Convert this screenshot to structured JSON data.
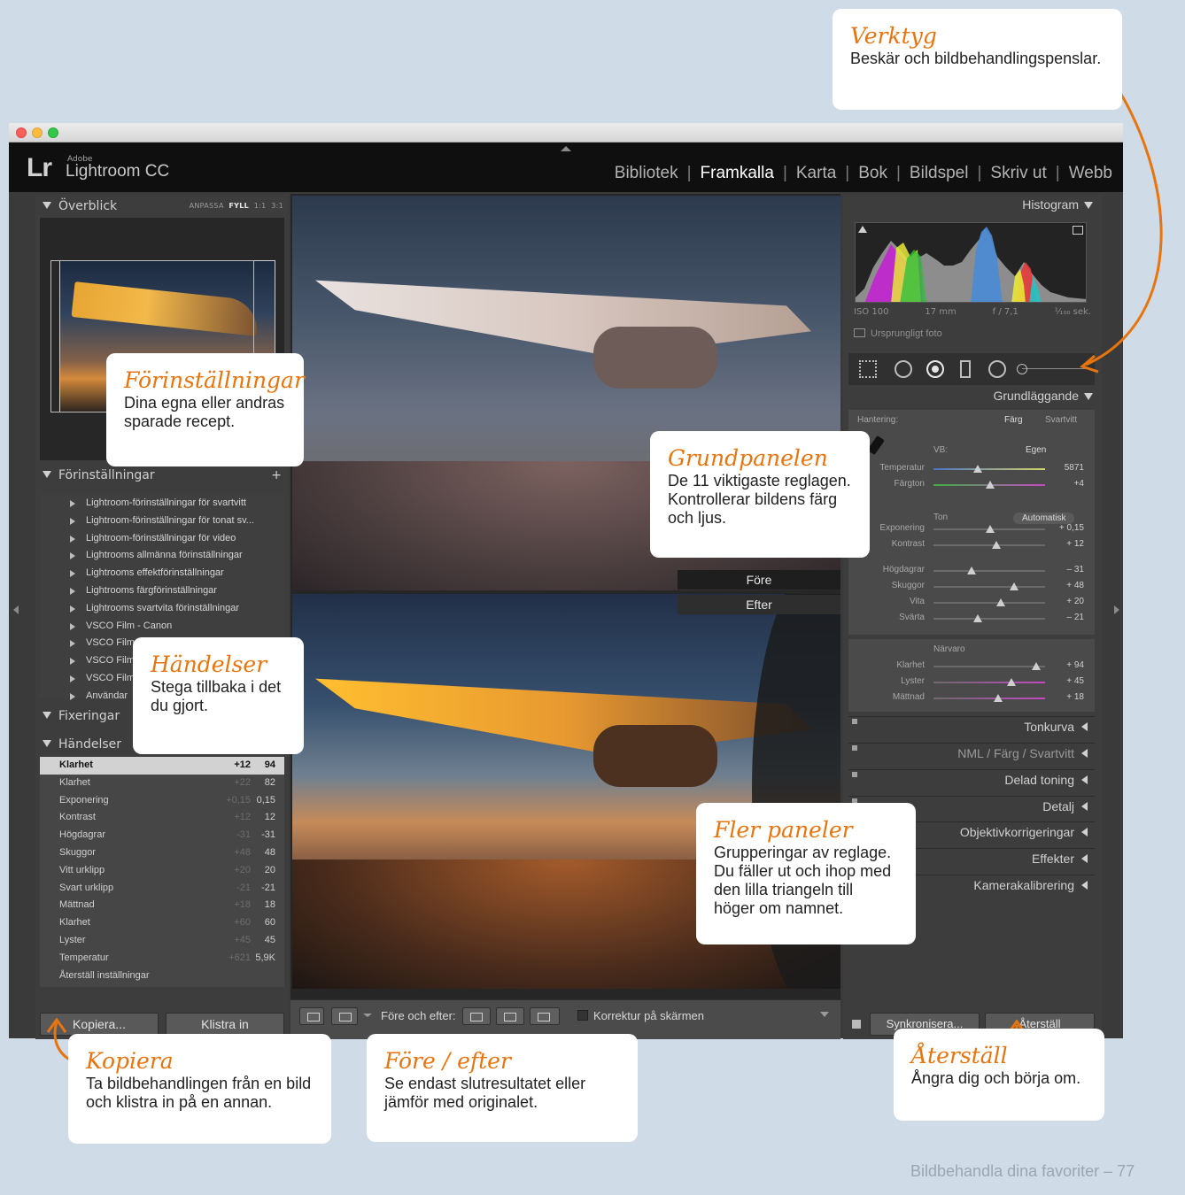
{
  "window": {
    "app_brand": "Lr",
    "app_vendor": "Adobe",
    "app_name": "Lightroom CC"
  },
  "modules": [
    "Bibliotek",
    "Framkalla",
    "Karta",
    "Bok",
    "Bildspel",
    "Skriv ut",
    "Webb"
  ],
  "active_module": "Framkalla",
  "left_panel": {
    "navigator": {
      "title": "Överblick",
      "zoom_options": [
        "ANPASSA",
        "FYLL",
        "1:1",
        "3:1"
      ],
      "zoom_selected": "FYLL"
    },
    "presets": {
      "title": "Förinställningar",
      "add": "+",
      "items": [
        "Lightroom-förinställningar för svartvitt",
        "Lightroom-förinställningar för tonat sv...",
        "Lightroom-förinställningar för video",
        "Lightrooms allmänna förinställningar",
        "Lightrooms effektförinställningar",
        "Lightrooms färgförinställningar",
        "Lightrooms svartvita förinställningar",
        "VSCO Film - Canon",
        "VSCO Film - Nikon",
        "VSCO Film",
        "VSCO Film",
        "Användar"
      ]
    },
    "snapshots": {
      "title": "Fixeringar"
    },
    "history": {
      "title": "Händelser",
      "rows": [
        {
          "name": "Klarhet",
          "delta": "+12",
          "value": "94"
        },
        {
          "name": "Klarhet",
          "delta": "+22",
          "value": "82"
        },
        {
          "name": "Exponering",
          "delta": "+0,15",
          "value": "0,15"
        },
        {
          "name": "Kontrast",
          "delta": "+12",
          "value": "12"
        },
        {
          "name": "Högdagrar",
          "delta": "-31",
          "value": "-31"
        },
        {
          "name": "Skuggor",
          "delta": "+48",
          "value": "48"
        },
        {
          "name": "Vitt urklipp",
          "delta": "+20",
          "value": "20"
        },
        {
          "name": "Svart urklipp",
          "delta": "-21",
          "value": "-21"
        },
        {
          "name": "Mättnad",
          "delta": "+18",
          "value": "18"
        },
        {
          "name": "Klarhet",
          "delta": "+60",
          "value": "60"
        },
        {
          "name": "Lyster",
          "delta": "+45",
          "value": "45"
        },
        {
          "name": "Temperatur",
          "delta": "+621",
          "value": "5,9K"
        },
        {
          "name": "Återställ inställningar",
          "delta": "",
          "value": ""
        }
      ]
    },
    "copy_button": "Kopiera...",
    "paste_button": "Klistra in"
  },
  "center": {
    "before_label": "Före",
    "after_label": "Efter",
    "toolbar": {
      "before_after_label": "Före och efter:",
      "softproof_label": "Korrektur på skärmen"
    }
  },
  "right_panel": {
    "histogram": {
      "title": "Histogram",
      "iso": "ISO 100",
      "focal": "17 mm",
      "aperture": "f / 7,1",
      "shutter": "¹⁄₁₀₀ sek.",
      "original_photo": "Ursprungligt foto"
    },
    "basic": {
      "title": "Grundläggande",
      "treatment_label": "Hantering:",
      "treatment_color": "Färg",
      "treatment_bw": "Svartvitt",
      "wb_label": "VB:",
      "wb_value": "Egen",
      "tone_label": "Ton",
      "auto_label": "Automatisk",
      "presence_label": "Närvaro",
      "sliders_wb": [
        {
          "name": "Temperatur",
          "value": "5871",
          "pos": 0.4
        },
        {
          "name": "Färgton",
          "value": "+4",
          "pos": 0.51
        }
      ],
      "sliders_tone": [
        {
          "name": "Exponering",
          "value": "+ 0,15",
          "pos": 0.51
        },
        {
          "name": "Kontrast",
          "value": "+ 12",
          "pos": 0.56
        },
        {
          "name": "Högdagrar",
          "value": "– 31",
          "pos": 0.34
        },
        {
          "name": "Skuggor",
          "value": "+ 48",
          "pos": 0.72
        },
        {
          "name": "Vita",
          "value": "+ 20",
          "pos": 0.6
        },
        {
          "name": "Svärta",
          "value": "– 21",
          "pos": 0.4
        }
      ],
      "sliders_presence": [
        {
          "name": "Klarhet",
          "value": "+ 94",
          "pos": 0.92
        },
        {
          "name": "Lyster",
          "value": "+ 45",
          "pos": 0.7
        },
        {
          "name": "Mättnad",
          "value": "+ 18",
          "pos": 0.58
        }
      ]
    },
    "panels": [
      {
        "label": "Tonkurva"
      },
      {
        "label": "NML / Färg / Svartvitt"
      },
      {
        "label": "Delad toning"
      },
      {
        "label": "Detalj"
      },
      {
        "label": "Objektivkorrigeringar"
      },
      {
        "label": "Effekter"
      },
      {
        "label": "Kamerakalibrering"
      }
    ],
    "sync_button": "Synkronisera...",
    "reset_button": "Återställ"
  },
  "callouts": {
    "verktyg": {
      "title": "Verktyg",
      "body": "Beskär och bildbehandlingspenslar."
    },
    "forinstallningar": {
      "title": "Förinställningar",
      "body": "Dina egna eller andras sparade recept."
    },
    "handelser": {
      "title": "Händelser",
      "body": "Stega tillbaka i det du gjort."
    },
    "grundpanelen": {
      "title": "Grundpanelen",
      "body": "De 11 viktigaste reglagen. Kontrollerar bildens färg och ljus."
    },
    "fler_paneler": {
      "title": "Fler paneler",
      "body": "Grupperingar av reglage. Du fäller ut och ihop med den lilla triangeln till höger om namnet."
    },
    "kopiera": {
      "title": "Kopiera",
      "body": "Ta bildbehandlingen från en bild och klistra in på en annan."
    },
    "fore_efter": {
      "title": "Före / efter",
      "body": "Se endast slutresultatet eller jämför med originalet."
    },
    "aterstall": {
      "title": "Återställ",
      "body": "Ångra dig och börja om."
    }
  },
  "footer": "Bildbehandla dina favoriter – 77",
  "colors": {
    "accent": "#e8740e",
    "page_bg": "#cfdbe7",
    "app_bg": "#3d3d3d"
  }
}
